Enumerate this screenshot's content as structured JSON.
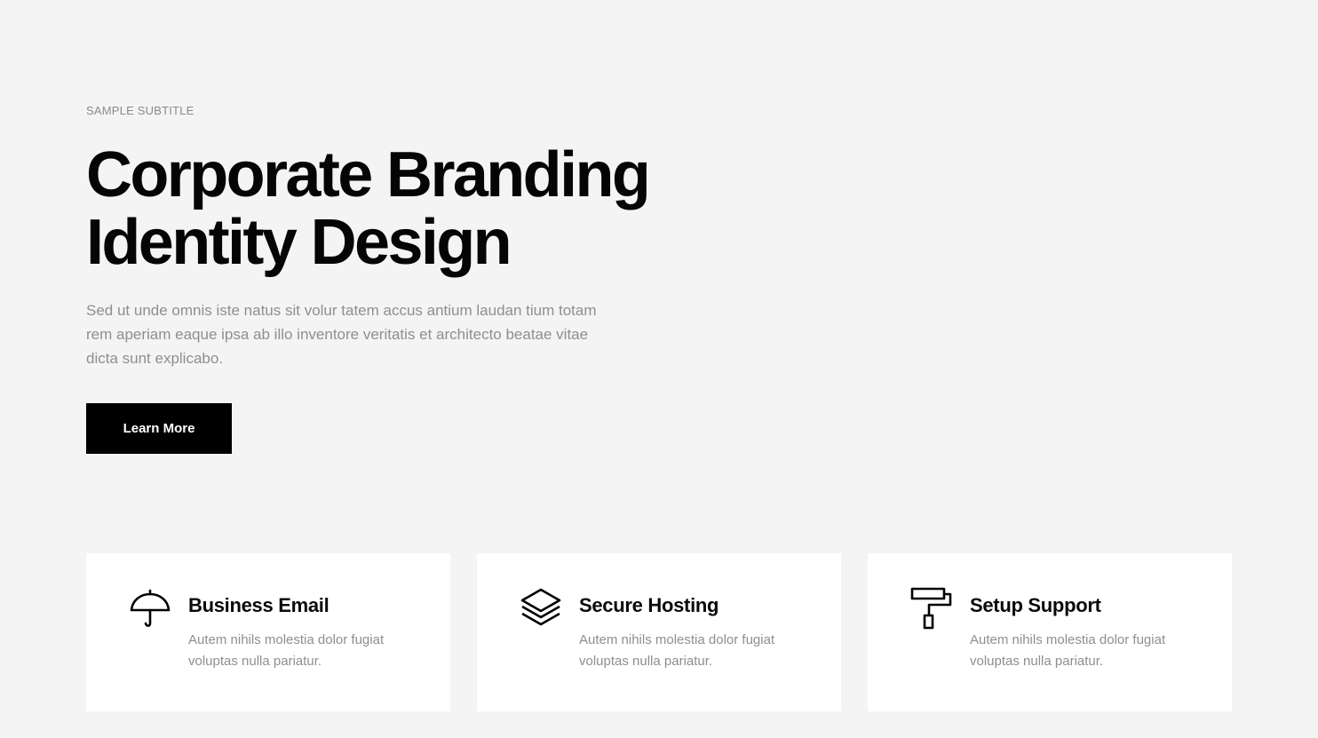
{
  "hero": {
    "subtitle": "SAMPLE SUBTITLE",
    "title_line1": "Corporate Branding",
    "title_line2": "Identity Design",
    "description": "Sed ut unde omnis iste natus sit volur tatem accus antium laudan tium totam rem aperiam eaque ipsa ab illo inventore veritatis et architecto beatae vitae dicta sunt explicabo.",
    "button_label": "Learn More"
  },
  "features": [
    {
      "icon": "umbrella-icon",
      "title": "Business Email",
      "text": "Autem nihils molestia dolor fugiat voluptas nulla pariatur."
    },
    {
      "icon": "layers-icon",
      "title": "Secure Hosting",
      "text": "Autem nihils molestia dolor fugiat voluptas nulla pariatur."
    },
    {
      "icon": "paint-roller-icon",
      "title": "Setup Support",
      "text": "Autem nihils molestia dolor fugiat voluptas nulla pariatur."
    }
  ],
  "colors": {
    "background": "#f4f4f4",
    "card_background": "#ffffff",
    "accent": "#000000",
    "muted_text": "#8f8f8f"
  }
}
